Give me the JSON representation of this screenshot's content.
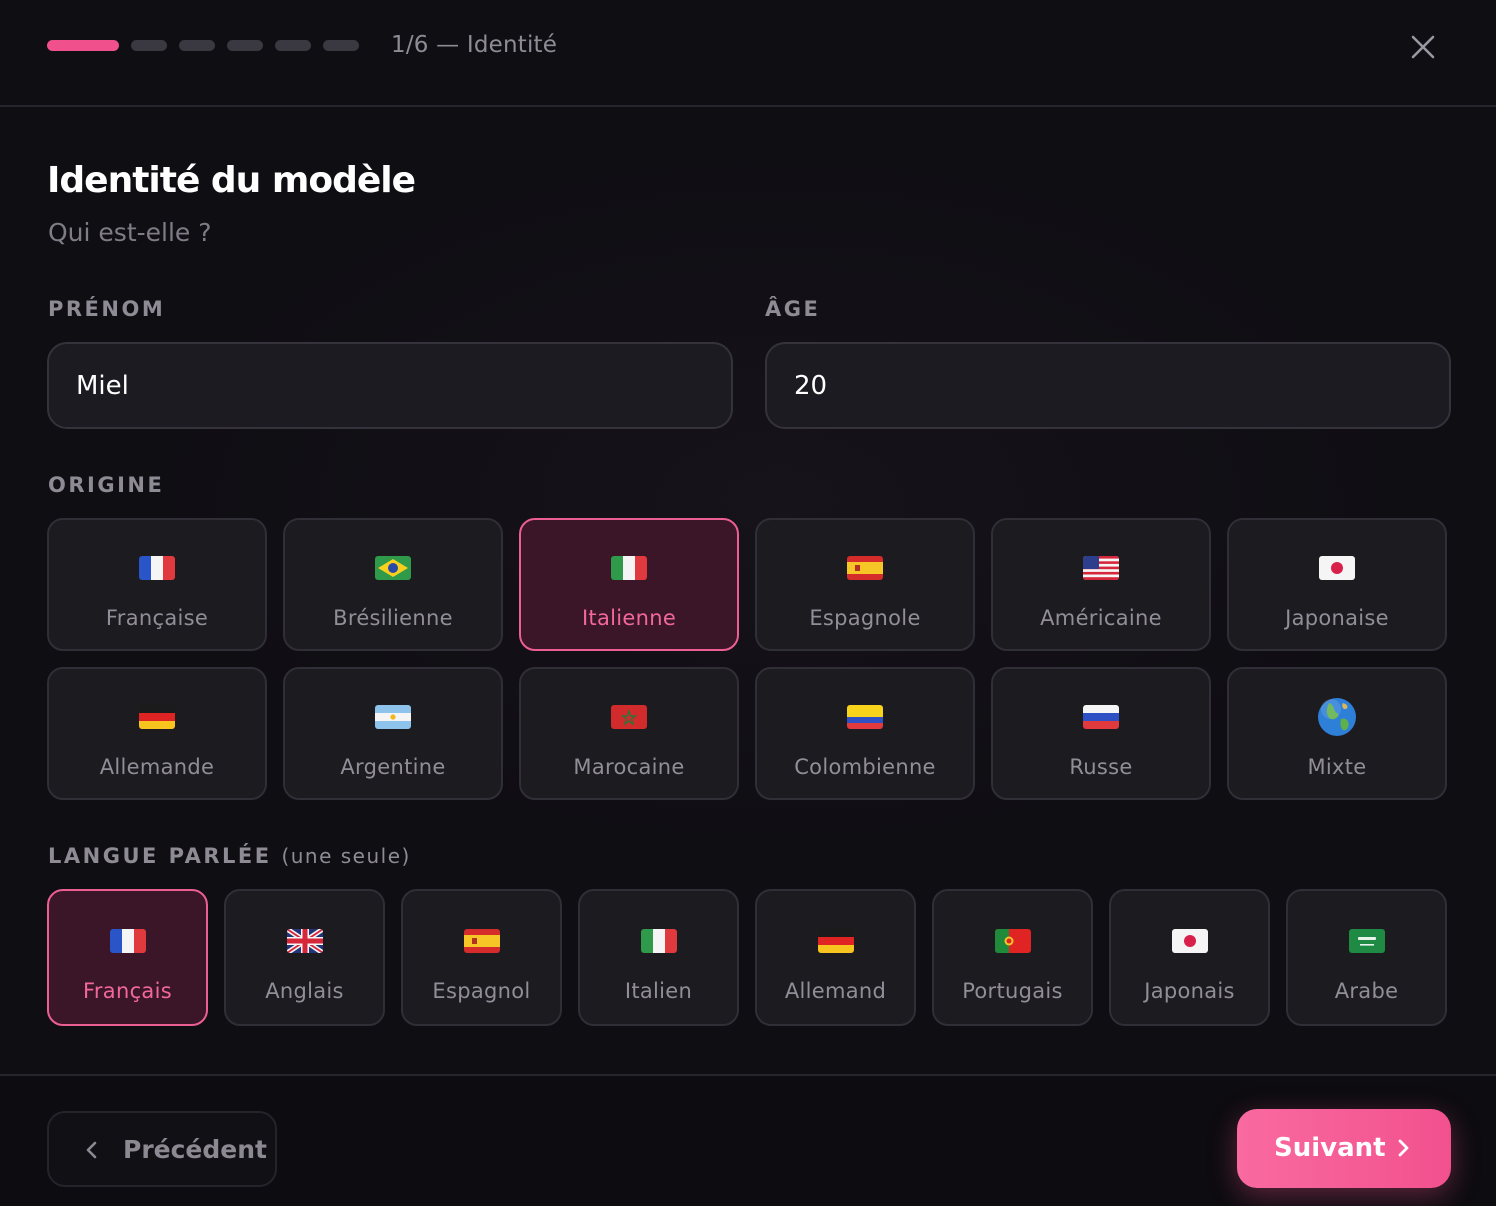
{
  "header": {
    "step_label": "1/6 — Identité",
    "progress": {
      "current_step": 1,
      "total_steps": 6
    }
  },
  "page": {
    "title": "Identité du modèle",
    "subtitle": "Qui est-elle ?"
  },
  "fields": {
    "first_name": {
      "label": "PRÉNOM",
      "value": "Miel"
    },
    "age": {
      "label": "ÂGE",
      "value": "20"
    }
  },
  "origin": {
    "label": "ORIGINE",
    "selected": "Italienne",
    "options": [
      {
        "name": "Française",
        "flag": "france-flag-icon"
      },
      {
        "name": "Brésilienne",
        "flag": "brazil-flag-icon"
      },
      {
        "name": "Italienne",
        "flag": "italy-flag-icon"
      },
      {
        "name": "Espagnole",
        "flag": "spain-flag-icon"
      },
      {
        "name": "Américaine",
        "flag": "usa-flag-icon"
      },
      {
        "name": "Japonaise",
        "flag": "japan-flag-icon"
      },
      {
        "name": "Allemande",
        "flag": "germany-flag-icon"
      },
      {
        "name": "Argentine",
        "flag": "argentina-flag-icon"
      },
      {
        "name": "Marocaine",
        "flag": "morocco-flag-icon"
      },
      {
        "name": "Colombienne",
        "flag": "colombia-flag-icon"
      },
      {
        "name": "Russe",
        "flag": "russia-flag-icon"
      },
      {
        "name": "Mixte",
        "flag": "globe-icon"
      }
    ]
  },
  "language": {
    "label": "LANGUE PARLÉE",
    "hint": "(une seule)",
    "selected": "Français",
    "options": [
      {
        "name": "Français",
        "flag": "france-flag-icon"
      },
      {
        "name": "Anglais",
        "flag": "uk-flag-icon"
      },
      {
        "name": "Espagnol",
        "flag": "spain-flag-icon"
      },
      {
        "name": "Italien",
        "flag": "italy-flag-icon"
      },
      {
        "name": "Allemand",
        "flag": "germany-flag-icon"
      },
      {
        "name": "Portugais",
        "flag": "portugal-flag-icon"
      },
      {
        "name": "Japonais",
        "flag": "japan-flag-icon"
      },
      {
        "name": "Arabe",
        "flag": "saudi-flag-icon"
      }
    ]
  },
  "footer": {
    "prev_label": "Précédent",
    "next_label": "Suivant"
  },
  "colors": {
    "accent": "#f0508c",
    "background": "#0f0e13",
    "card": "#1c1b20",
    "selected_card": "#3a1628"
  }
}
